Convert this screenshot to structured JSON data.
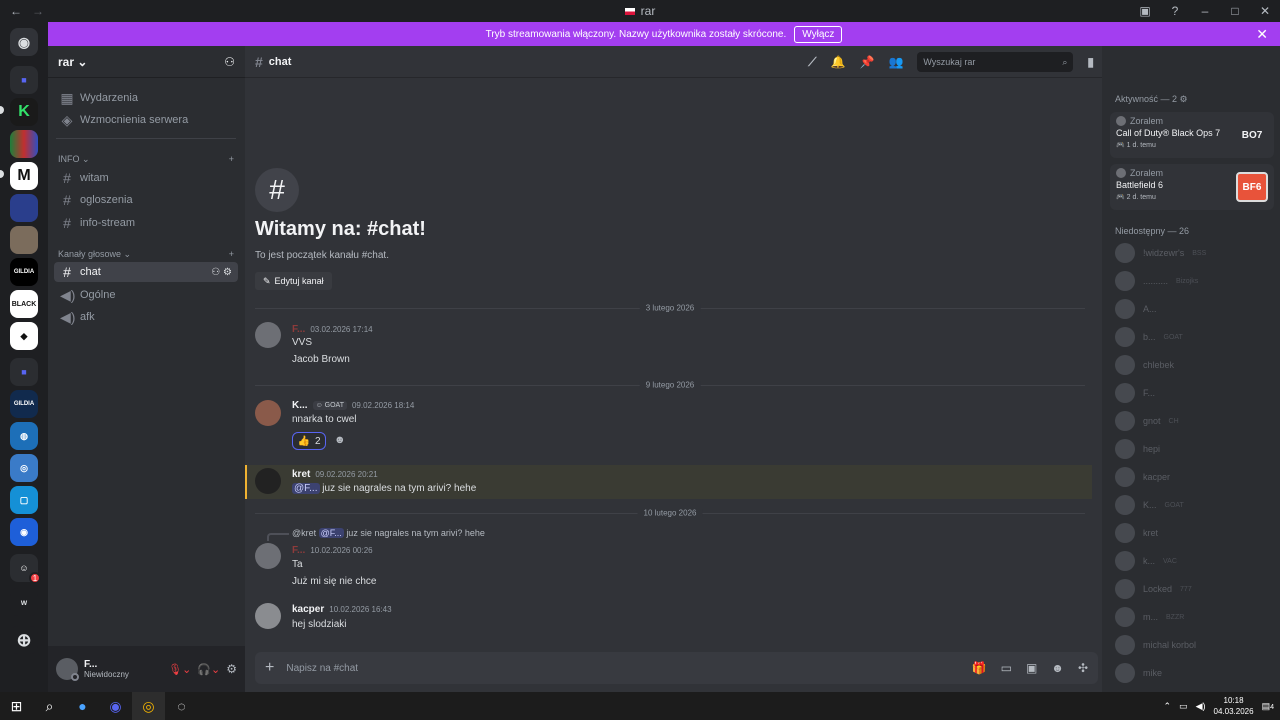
{
  "window": {
    "title": "rar"
  },
  "banner": {
    "text": "Tryb streamowania włączony. Nazwy użytkownika zostały skrócone.",
    "button": "Wyłącz"
  },
  "servers": [
    {
      "label": "K",
      "color": "#1e1f22"
    },
    {
      "label": "W",
      "color": "#2b2d31"
    }
  ],
  "guild": {
    "name": "rar"
  },
  "sidebar": {
    "events": "Wydarzenia",
    "boosts": "Wzmocnienia serwera",
    "cat_info": "INFO",
    "ch_witam": "witam",
    "ch_ogloszenia": "ogloszenia",
    "ch_infostream": "info-stream",
    "cat_voice": "Kanały głosowe",
    "ch_chat": "chat",
    "ch_ogolne": "Ogólne",
    "ch_afk": "afk"
  },
  "user": {
    "name": "F...",
    "status": "Niewidoczny"
  },
  "channel": {
    "name": "chat",
    "search_placeholder": "Wyszukaj rar"
  },
  "welcome": {
    "title": "Witamy na: #chat!",
    "subtitle": "To jest początek kanału #chat.",
    "edit": "Edytuj kanał"
  },
  "dividers": [
    "3 lutego 2026",
    "9 lutego 2026",
    "10 lutego 2026"
  ],
  "messages": [
    {
      "author": "F...",
      "time": "03.02.2026 17:14",
      "lines": [
        "VVS",
        "Jacob Brown"
      ]
    },
    {
      "author": "K...",
      "tag": "GOAT",
      "time": "09.02.2026 18:14",
      "lines": [
        "nnarka to cwel"
      ],
      "reaction_count": "2"
    },
    {
      "author": "kret",
      "time": "09.02.2026 20:21",
      "mention": "@F...",
      "text": "juz sie nagrales na tym arivi? hehe"
    },
    {
      "reply_author": "@kret",
      "reply_mention": "@F...",
      "reply_text": "juz sie nagrales na tym arivi? hehe",
      "author": "F...",
      "time": "10.02.2026 00:26",
      "lines": [
        "Ta",
        "Już mi się nie chce"
      ]
    },
    {
      "author": "kacper",
      "time": "10.02.2026 16:43",
      "lines": [
        "hej slodziaki"
      ]
    }
  ],
  "composer": {
    "placeholder": "Napisz na #chat"
  },
  "members": {
    "activity_header": "Aktywność — 2",
    "activities": [
      {
        "user": "Zoralem",
        "game": "Call of Duty® Black Ops 7",
        "time": "1 d. temu",
        "logo": "BO7"
      },
      {
        "user": "Zoralem",
        "game": "Battlefield 6",
        "time": "2 d. temu",
        "logo": "BF6"
      }
    ],
    "offline_header": "Niedostępny — 26",
    "list": [
      {
        "name": "!widzewr's",
        "tag": "BSS"
      },
      {
        "name": "..........",
        "tag": "Bizojks"
      },
      {
        "name": "A...",
        "tag": ""
      },
      {
        "name": "b...",
        "tag": "GOAT"
      },
      {
        "name": "chlebek",
        "tag": ""
      },
      {
        "name": "F...",
        "tag": ""
      },
      {
        "name": "gnot",
        "tag": "CH"
      },
      {
        "name": "hepi",
        "tag": ""
      },
      {
        "name": "kacper",
        "tag": ""
      },
      {
        "name": "K...",
        "tag": "GOAT"
      },
      {
        "name": "kret",
        "tag": ""
      },
      {
        "name": "k...",
        "tag": "VAC"
      },
      {
        "name": "Locked",
        "tag": "777"
      },
      {
        "name": "m...",
        "tag": "BZZR"
      },
      {
        "name": "michal korbol",
        "tag": ""
      },
      {
        "name": "mike",
        "tag": ""
      }
    ]
  },
  "taskbar": {
    "time": "10:18",
    "date": "04.03.2026",
    "notifications": "4"
  }
}
